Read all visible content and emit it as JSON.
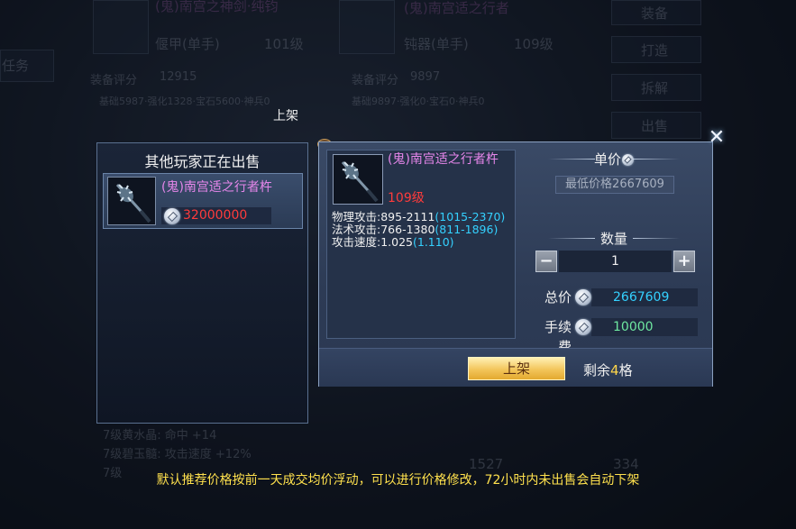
{
  "background": {
    "item1_name": "(鬼)南宫之神剑·纯钧",
    "item1_type": "偃甲(单手)",
    "item1_level": "101级",
    "item1_score_label": "装备评分",
    "item1_score": "12915",
    "item1_detail": "基础5987·强化1328·宝石5600·神兵0",
    "item2_name": "(鬼)南宫适之行者",
    "item2_type": "钝器(单手)",
    "item2_level": "109级",
    "item2_score_label": "装备评分",
    "item2_score": "9897",
    "item2_detail": "基础9897·强化0·宝石0·神兵0",
    "side_buttons": [
      "装备",
      "打造",
      "拆解",
      "出售"
    ],
    "tab": "任务",
    "bottom_lines": [
      "7级黄水晶: 命中 +14",
      "7级碧玉髓: 攻击速度 +12%",
      "7级"
    ],
    "stat_values": [
      "1527",
      "334"
    ]
  },
  "float_label": "上架",
  "left_panel": {
    "title": "其他玩家正在出售",
    "listings": [
      {
        "name": "(鬼)南宫适之行者杵",
        "price": "32000000",
        "icon": "mace-icon"
      }
    ]
  },
  "dialog": {
    "item": {
      "name": "(鬼)南宫适之行者杵",
      "level": "109级",
      "icon": "mace-icon",
      "stats": [
        {
          "label": "物理攻击:895-2111",
          "bonus": "(1015-2370)"
        },
        {
          "label": "法术攻击:766-1380",
          "bonus": "(811-1896)"
        },
        {
          "label": "攻击速度:1.025",
          "bonus": "(1.110)"
        }
      ]
    },
    "unit_price_title": "单价",
    "min_price_text": "最低价格2667609",
    "quantity_title": "数量",
    "quantity": "1",
    "minus_label": "−",
    "plus_label": "+",
    "total_label": "总价",
    "total_value": "2667609",
    "fee_label": "手续费",
    "fee_value": "10000",
    "list_button": "上架",
    "remaining_prefix": "剩余",
    "remaining_count": "4",
    "remaining_suffix": "格",
    "close_label": "✕"
  },
  "tip": "默认推荐价格按前一天成交均价浮动，可以进行价格修改，72小时内未出售会自动下架",
  "colors": {
    "item_name": "#e586ea",
    "price_red": "#ff3b3b",
    "value_blue": "#34d1ff",
    "fee_green": "#6ee7a0",
    "tip_yellow": "#ffe14d",
    "button_gold": "#f3c55a"
  }
}
